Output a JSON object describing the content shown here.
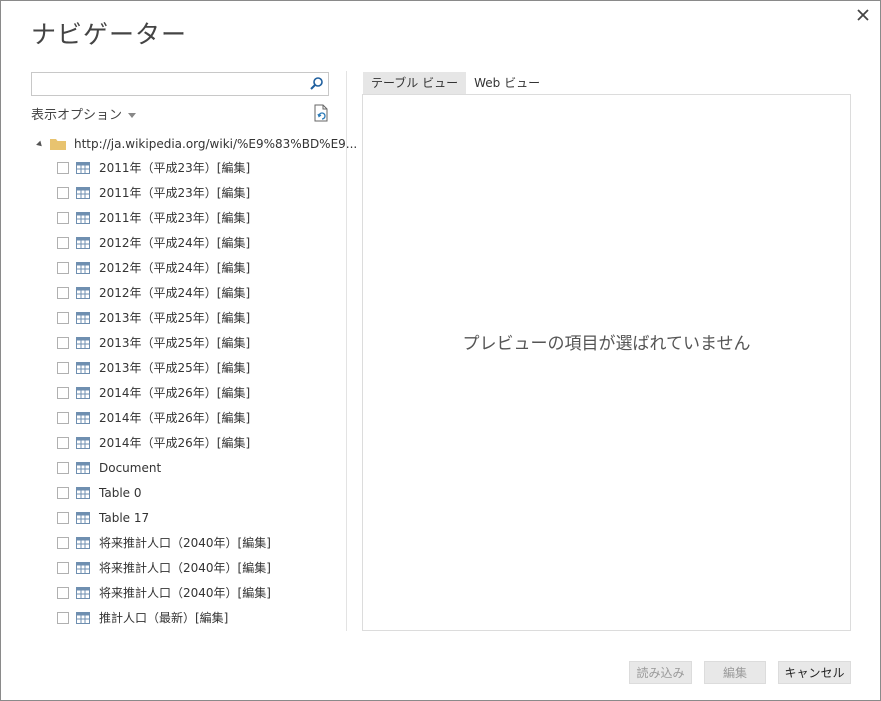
{
  "window": {
    "title": "ナビゲーター"
  },
  "search": {
    "placeholder": "",
    "value": ""
  },
  "display_options": {
    "label": "表示オプション"
  },
  "tree": {
    "root_label": "http://ja.wikipedia.org/wiki/%E9%83%BD%E9...",
    "items": [
      "2011年（平成23年）[編集]",
      "2011年（平成23年）[編集]",
      "2011年（平成23年）[編集]",
      "2012年（平成24年）[編集]",
      "2012年（平成24年）[編集]",
      "2012年（平成24年）[編集]",
      "2013年（平成25年）[編集]",
      "2013年（平成25年）[編集]",
      "2013年（平成25年）[編集]",
      "2014年（平成26年）[編集]",
      "2014年（平成26年）[編集]",
      "2014年（平成26年）[編集]",
      "Document",
      "Table 0",
      "Table 17",
      "将来推計人口（2040年）[編集]",
      "将来推計人口（2040年）[編集]",
      "将来推計人口（2040年）[編集]",
      "推計人口（最新）[編集]"
    ]
  },
  "tabs": [
    {
      "label": "テーブル ビュー",
      "active": true
    },
    {
      "label": "Web ビュー",
      "active": false
    }
  ],
  "preview": {
    "empty_message": "プレビューの項目が選ばれていません"
  },
  "buttons": {
    "load": "読み込み",
    "edit": "編集",
    "cancel": "キャンセル"
  },
  "colors": {
    "folder": "#e8c36f",
    "table_icon": "#6f8fb0"
  }
}
